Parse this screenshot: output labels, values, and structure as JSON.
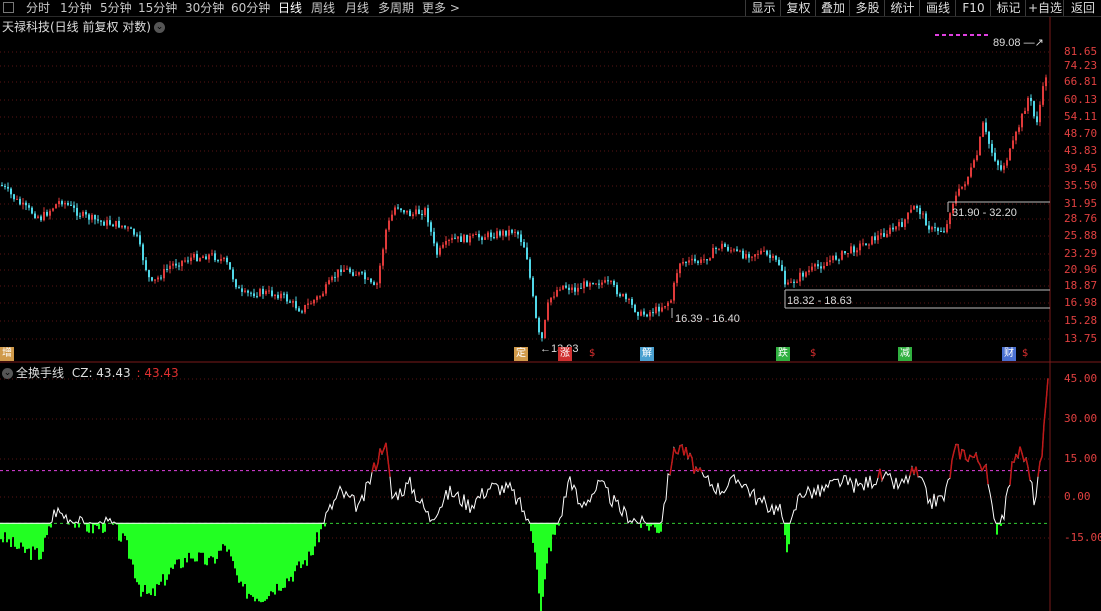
{
  "toolbar": {
    "periods": [
      "分时",
      "1分钟",
      "5分钟",
      "15分钟",
      "30分钟",
      "60分钟",
      "日线",
      "周线",
      "月线",
      "多周期",
      "更多 >"
    ],
    "active_period": "日线",
    "right_buttons": [
      "显示",
      "复权",
      "叠加",
      "多股",
      "统计",
      "画线",
      "F10",
      "标记",
      "+自选",
      "返回"
    ]
  },
  "main_chart": {
    "title": "天禄科技(日线 前复权 对数)",
    "price_axis": [
      "81.65",
      "74.23",
      "66.81",
      "60.13",
      "54.11",
      "48.70",
      "43.83",
      "39.45",
      "35.50",
      "31.95",
      "28.76",
      "25.88",
      "23.29",
      "20.96",
      "18.87",
      "16.98",
      "15.28",
      "13.75"
    ],
    "annotations": {
      "high": "89.08",
      "low": "13.93",
      "range1": "31.90 - 32.20",
      "range2": "18.32 - 18.63",
      "range3": "16.39 - 16.40"
    },
    "event_badges": [
      {
        "text": "增",
        "color": "#d09a4a"
      },
      {
        "text": "定",
        "color": "#d09a4a"
      },
      {
        "text": "涨",
        "color": "#d03030"
      },
      {
        "text": "$",
        "color": "#e03030"
      },
      {
        "text": "解",
        "color": "#4aa0d0"
      },
      {
        "text": "跌",
        "color": "#30b040"
      },
      {
        "text": "$",
        "color": "#e03030"
      },
      {
        "text": "减",
        "color": "#30b040"
      },
      {
        "text": "财",
        "color": "#4a70d0"
      },
      {
        "text": "$",
        "color": "#e03030"
      }
    ]
  },
  "sub_chart": {
    "name": "全换手线",
    "cz_label": "CZ: 43.43",
    "cz_value2": ": 43.43",
    "axis": [
      "45.00",
      "30.00",
      "15.00",
      "0.00",
      "-15.00"
    ]
  },
  "colors": {
    "up": "#e03a3a",
    "down": "#50d8e8",
    "bull": "#c01818",
    "bear": "#22ff22",
    "line": "#ffffff",
    "grid": "#5a1414",
    "magenta": "#e040e0"
  }
}
